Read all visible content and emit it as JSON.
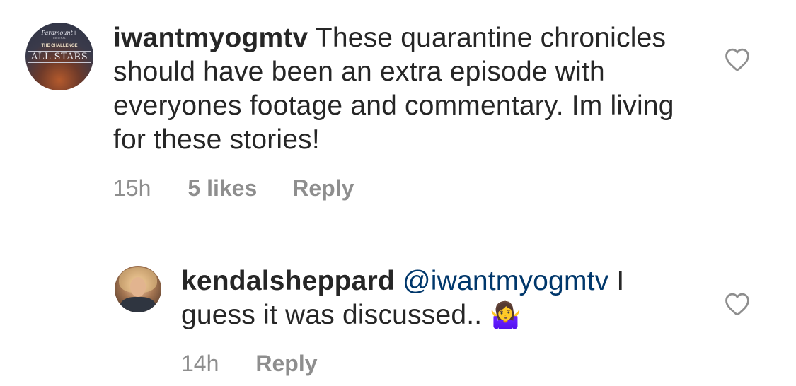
{
  "comments": [
    {
      "username": "iwantmyogmtv",
      "text": "These quarantine chronicles should have been an extra episode with everyones footage and commentary. Im living for these stories!",
      "time": "15h",
      "likes": "5 likes",
      "reply_label": "Reply",
      "avatar": {
        "brand": "Paramount+",
        "sub": "ORIGINAL",
        "show": "THE CHALLENGE",
        "title": "ALL STARS"
      }
    },
    {
      "username": "kendalsheppard",
      "mention": "@iwantmyogmtv",
      "text": "I guess it was discussed..",
      "emoji": "🤷‍♀️",
      "time": "14h",
      "reply_label": "Reply"
    }
  ],
  "icons": {
    "like": "heart-outline-icon"
  },
  "colors": {
    "text": "#262626",
    "meta": "#8e8e8e",
    "mention": "#00376b"
  }
}
